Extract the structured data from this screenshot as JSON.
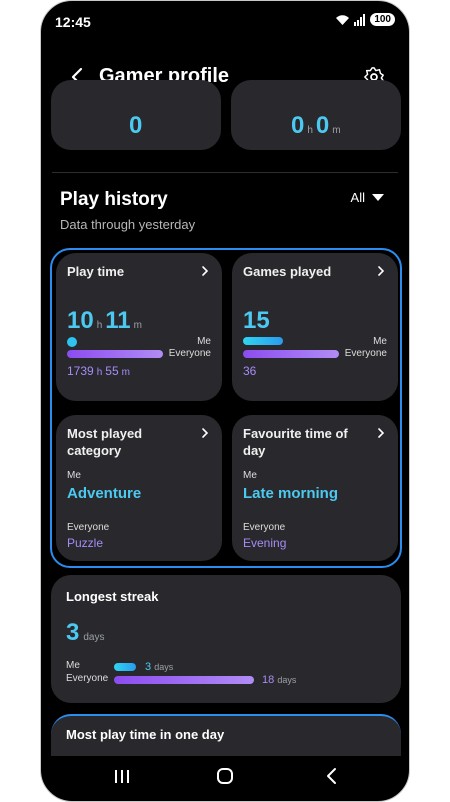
{
  "status": {
    "time": "12:45",
    "battery": "100"
  },
  "app": {
    "title": "Gamer profile"
  },
  "top": {
    "left_value": "0",
    "right_h": "0",
    "right_h_unit": "h",
    "right_m": "0",
    "right_m_unit": "m"
  },
  "history": {
    "title": "Play history",
    "filter": "All",
    "subtitle": "Data through yesterday"
  },
  "play_time": {
    "label": "Play time",
    "hours": "10",
    "h": "h",
    "minutes": "11",
    "m": "m",
    "me": "Me",
    "everyone": "Everyone",
    "ev_hours": "1739",
    "ev_h": "h",
    "ev_minutes": "55",
    "ev_m": "m"
  },
  "games_played": {
    "label": "Games played",
    "me_value": "15",
    "me": "Me",
    "everyone": "Everyone",
    "ev_value": "36"
  },
  "most_played": {
    "label": "Most played category",
    "me": "Me",
    "me_value": "Adventure",
    "everyone": "Everyone",
    "ev_value": "Puzzle"
  },
  "fav_time": {
    "label": "Favourite time of day",
    "me": "Me",
    "me_value": "Late morning",
    "everyone": "Everyone",
    "ev_value": "Evening"
  },
  "streak": {
    "title": "Longest streak",
    "value": "3",
    "unit": "days",
    "me": "Me",
    "everyone": "Everyone",
    "me_value": "3",
    "me_unit": "days",
    "ev_value": "18",
    "ev_unit": "days"
  },
  "most_play_day": {
    "title": "Most play time in one day"
  },
  "colors": {
    "accent": "#4cc9f0",
    "purple": "#a78bf6",
    "highlight": "#2b8df0",
    "card": "#29292d"
  }
}
